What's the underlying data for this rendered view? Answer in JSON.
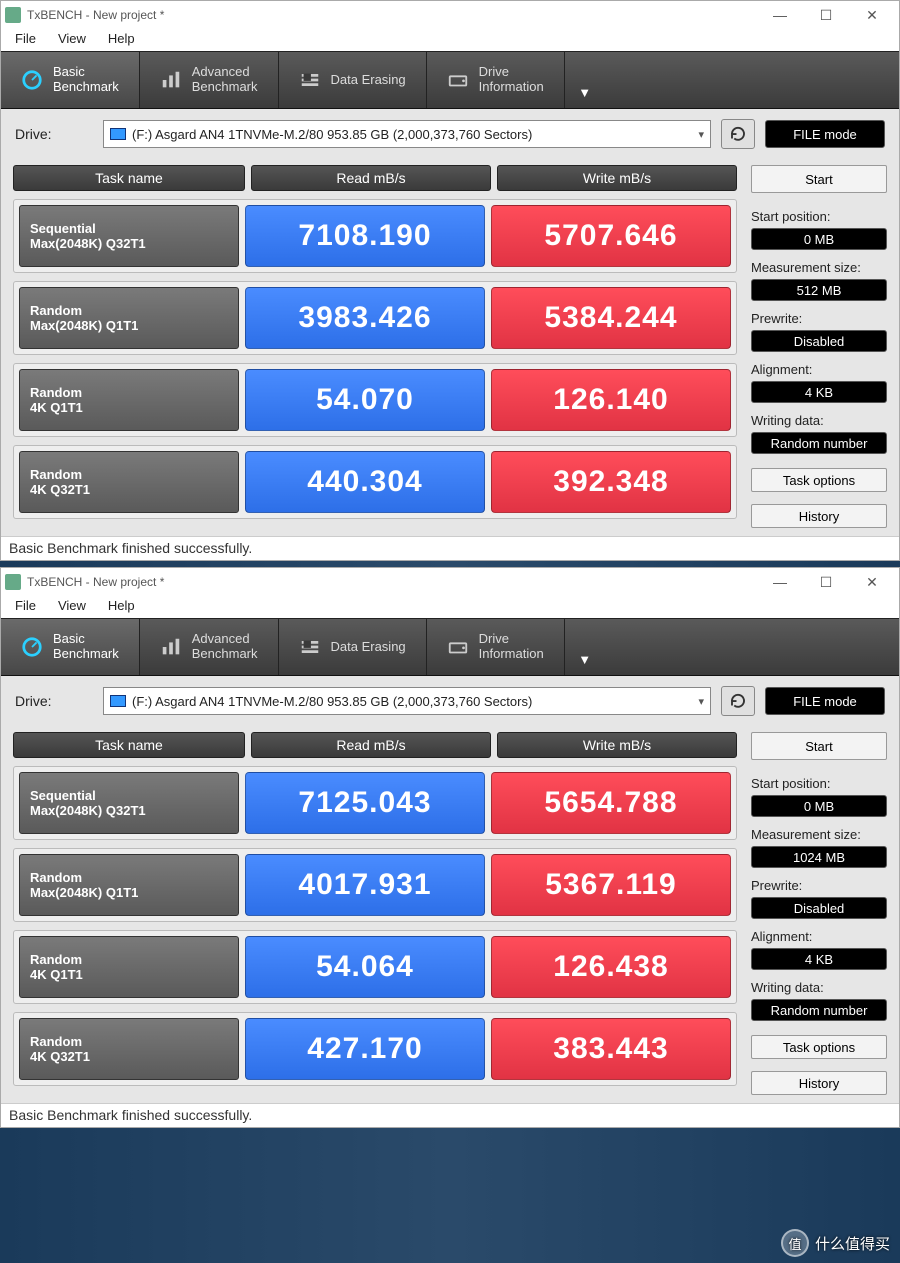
{
  "windows": [
    {
      "title": "TxBENCH - New project *",
      "menubar": [
        "File",
        "View",
        "Help"
      ],
      "ribbon": [
        {
          "label": "Basic\nBenchmark",
          "icon": "gauge-icon",
          "active": true
        },
        {
          "label": "Advanced\nBenchmark",
          "icon": "bars-icon",
          "active": false
        },
        {
          "label": "Data Erasing",
          "icon": "erase-icon",
          "active": false
        },
        {
          "label": "Drive\nInformation",
          "icon": "drive-icon",
          "active": false
        }
      ],
      "drive_label": "Drive:",
      "drive_value": "(F:) Asgard AN4 1TNVMe-M.2/80  953.85 GB (2,000,373,760 Sectors)",
      "filemode": "FILE mode",
      "headers": {
        "task": "Task name",
        "read": "Read mB/s",
        "write": "Write mB/s"
      },
      "rows": [
        {
          "t1": "Sequential",
          "t2": "Max(2048K) Q32T1",
          "read": "7108.190",
          "write": "5707.646"
        },
        {
          "t1": "Random",
          "t2": "Max(2048K) Q1T1",
          "read": "3983.426",
          "write": "5384.244"
        },
        {
          "t1": "Random",
          "t2": "4K Q1T1",
          "read": "54.070",
          "write": "126.140"
        },
        {
          "t1": "Random",
          "t2": "4K Q32T1",
          "read": "440.304",
          "write": "392.348"
        }
      ],
      "side": {
        "start": "Start",
        "start_pos_lbl": "Start position:",
        "start_pos": "0 MB",
        "meas_lbl": "Measurement size:",
        "meas": "512 MB",
        "prewrite_lbl": "Prewrite:",
        "prewrite": "Disabled",
        "align_lbl": "Alignment:",
        "align": "4 KB",
        "wdata_lbl": "Writing data:",
        "wdata": "Random number",
        "taskopt": "Task options",
        "history": "History"
      },
      "status": "Basic Benchmark finished successfully."
    },
    {
      "title": "TxBENCH - New project *",
      "menubar": [
        "File",
        "View",
        "Help"
      ],
      "ribbon": [
        {
          "label": "Basic\nBenchmark",
          "icon": "gauge-icon",
          "active": true
        },
        {
          "label": "Advanced\nBenchmark",
          "icon": "bars-icon",
          "active": false
        },
        {
          "label": "Data Erasing",
          "icon": "erase-icon",
          "active": false
        },
        {
          "label": "Drive\nInformation",
          "icon": "drive-icon",
          "active": false
        }
      ],
      "drive_label": "Drive:",
      "drive_value": "(F:) Asgard AN4 1TNVMe-M.2/80  953.85 GB (2,000,373,760 Sectors)",
      "filemode": "FILE mode",
      "headers": {
        "task": "Task name",
        "read": "Read mB/s",
        "write": "Write mB/s"
      },
      "rows": [
        {
          "t1": "Sequential",
          "t2": "Max(2048K) Q32T1",
          "read": "7125.043",
          "write": "5654.788"
        },
        {
          "t1": "Random",
          "t2": "Max(2048K) Q1T1",
          "read": "4017.931",
          "write": "5367.119"
        },
        {
          "t1": "Random",
          "t2": "4K Q1T1",
          "read": "54.064",
          "write": "126.438"
        },
        {
          "t1": "Random",
          "t2": "4K Q32T1",
          "read": "427.170",
          "write": "383.443"
        }
      ],
      "side": {
        "start": "Start",
        "start_pos_lbl": "Start position:",
        "start_pos": "0 MB",
        "meas_lbl": "Measurement size:",
        "meas": "1024 MB",
        "prewrite_lbl": "Prewrite:",
        "prewrite": "Disabled",
        "align_lbl": "Alignment:",
        "align": "4 KB",
        "wdata_lbl": "Writing data:",
        "wdata": "Random number",
        "taskopt": "Task options",
        "history": "History"
      },
      "status": "Basic Benchmark finished successfully."
    }
  ],
  "watermark": "什么值得买",
  "watermark_badge": "值",
  "chart_data": {
    "type": "table",
    "title": "TxBENCH Basic Benchmark — Asgard AN4 1T NVMe",
    "units": "MB/s",
    "runs": [
      {
        "measurement_size": "512 MB",
        "rows": [
          {
            "task": "Sequential Max(2048K) Q32T1",
            "read": 7108.19,
            "write": 5707.646
          },
          {
            "task": "Random Max(2048K) Q1T1",
            "read": 3983.426,
            "write": 5384.244
          },
          {
            "task": "Random 4K Q1T1",
            "read": 54.07,
            "write": 126.14
          },
          {
            "task": "Random 4K Q32T1",
            "read": 440.304,
            "write": 392.348
          }
        ]
      },
      {
        "measurement_size": "1024 MB",
        "rows": [
          {
            "task": "Sequential Max(2048K) Q32T1",
            "read": 7125.043,
            "write": 5654.788
          },
          {
            "task": "Random Max(2048K) Q1T1",
            "read": 4017.931,
            "write": 5367.119
          },
          {
            "task": "Random 4K Q1T1",
            "read": 54.064,
            "write": 126.438
          },
          {
            "task": "Random 4K Q32T1",
            "read": 427.17,
            "write": 383.443
          }
        ]
      }
    ]
  }
}
